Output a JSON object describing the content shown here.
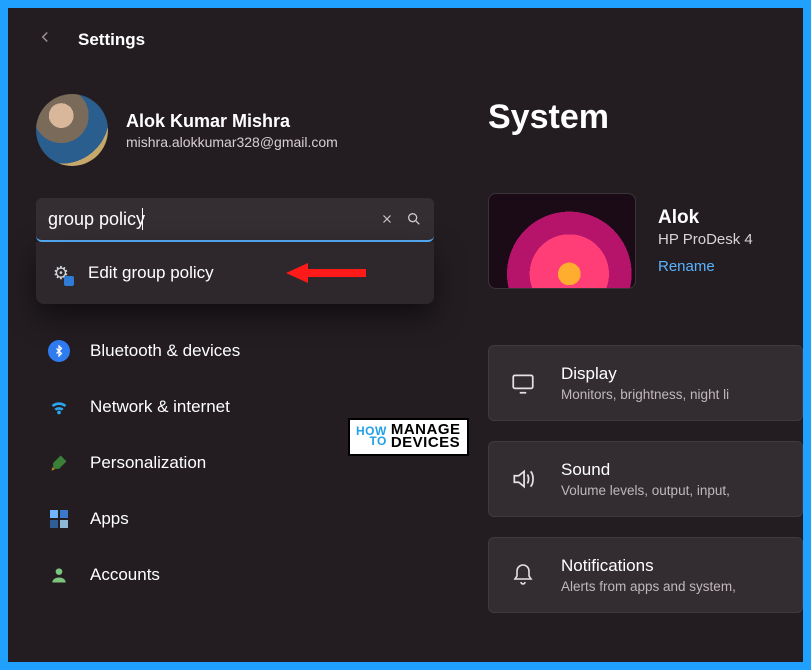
{
  "header": {
    "title": "Settings"
  },
  "user": {
    "name": "Alok Kumar Mishra",
    "email": "mishra.alokkumar328@gmail.com"
  },
  "search": {
    "value": "group policy",
    "result_label": "Edit group policy"
  },
  "sidebar": {
    "items": [
      {
        "label": "Bluetooth & devices"
      },
      {
        "label": "Network & internet"
      },
      {
        "label": "Personalization"
      },
      {
        "label": "Apps"
      },
      {
        "label": "Accounts"
      }
    ]
  },
  "main": {
    "title": "System",
    "device": {
      "name": "Alok",
      "model": "HP ProDesk 4",
      "rename": "Rename"
    },
    "tiles": [
      {
        "title": "Display",
        "sub": "Monitors, brightness, night li"
      },
      {
        "title": "Sound",
        "sub": "Volume levels, output, input,"
      },
      {
        "title": "Notifications",
        "sub": "Alerts from apps and system,"
      }
    ]
  },
  "watermark": {
    "how1": "HOW",
    "how2": "TO",
    "md1": "MANAGE",
    "md2": "DEVICES"
  }
}
